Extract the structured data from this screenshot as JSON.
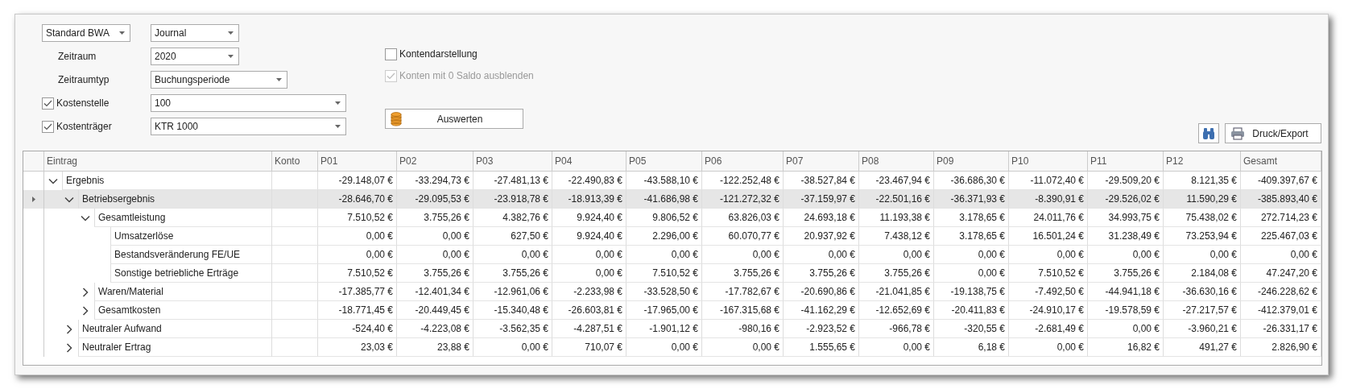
{
  "report_select": {
    "value": "Standard BWA"
  },
  "view_select": {
    "value": "Journal"
  },
  "filters": [
    {
      "kind": "select",
      "label": "Zeitraum",
      "value": "2020"
    },
    {
      "kind": "select",
      "label": "Zeitraumtyp",
      "value": "Buchungsperiode"
    },
    {
      "kind": "checkbox",
      "label": "Kostenstelle",
      "checked": true,
      "value": "100"
    },
    {
      "kind": "checkbox",
      "label": "Kostenträger",
      "checked": true,
      "value": "KTR 1000"
    }
  ],
  "options": [
    {
      "label": "Kontendarstellung",
      "checked": false,
      "disabled": false
    },
    {
      "label": "Konten mit 0 Saldo ausblenden",
      "checked": true,
      "disabled": true
    }
  ],
  "evaluate_button": "Auswerten",
  "export_button": "Druck/Export",
  "table": {
    "columns": [
      "Eintrag",
      "Konto",
      "P01",
      "P02",
      "P03",
      "P04",
      "P05",
      "P06",
      "P07",
      "P08",
      "P09",
      "P10",
      "P11",
      "P12",
      "Gesamt"
    ],
    "rows": [
      {
        "label": "Ergebnis",
        "expanded": true,
        "selected": false,
        "values": [
          "-29.148,07 €",
          "-33.294,73 €",
          "-27.481,13 €",
          "-22.490,83 €",
          "-43.588,10 €",
          "-122.252,48 €",
          "-38.527,84 €",
          "-23.467,94 €",
          "-36.686,30 €",
          "-11.072,40 €",
          "-29.509,20 €",
          "8.121,35 €",
          "-409.397,67 €"
        ],
        "children": [
          {
            "label": "Betriebsergebnis",
            "expanded": true,
            "selected": true,
            "values": [
              "-28.646,70 €",
              "-29.095,53 €",
              "-23.918,78 €",
              "-18.913,39 €",
              "-41.686,98 €",
              "-121.272,32 €",
              "-37.159,97 €",
              "-22.501,16 €",
              "-36.371,93 €",
              "-8.390,91 €",
              "-29.526,02 €",
              "11.590,29 €",
              "-385.893,40 €"
            ],
            "children": [
              {
                "label": "Gesamtleistung",
                "expanded": true,
                "selected": false,
                "values": [
                  "7.510,52 €",
                  "3.755,26 €",
                  "4.382,76 €",
                  "9.924,40 €",
                  "9.806,52 €",
                  "63.826,03 €",
                  "24.693,18 €",
                  "11.193,38 €",
                  "3.178,65 €",
                  "24.011,76 €",
                  "34.993,75 €",
                  "75.438,02 €",
                  "272.714,23 €"
                ],
                "children": [
                  {
                    "label": "Umsatzerlöse",
                    "selected": false,
                    "values": [
                      "0,00 €",
                      "0,00 €",
                      "627,50 €",
                      "9.924,40 €",
                      "2.296,00 €",
                      "60.070,77 €",
                      "20.937,92 €",
                      "7.438,12 €",
                      "3.178,65 €",
                      "16.501,24 €",
                      "31.238,49 €",
                      "73.253,94 €",
                      "225.467,03 €"
                    ]
                  },
                  {
                    "label": "Bestandsveränderung  FE/UE",
                    "selected": false,
                    "values": [
                      "0,00 €",
                      "0,00 €",
                      "0,00 €",
                      "0,00 €",
                      "0,00 €",
                      "0,00 €",
                      "0,00 €",
                      "0,00 €",
                      "0,00 €",
                      "0,00 €",
                      "0,00 €",
                      "0,00 €",
                      "0,00 €"
                    ]
                  },
                  {
                    "label": "Sonstige betriebliche Erträge",
                    "selected": false,
                    "values": [
                      "7.510,52 €",
                      "3.755,26 €",
                      "3.755,26 €",
                      "0,00 €",
                      "7.510,52 €",
                      "3.755,26 €",
                      "3.755,26 €",
                      "3.755,26 €",
                      "0,00 €",
                      "7.510,52 €",
                      "3.755,26 €",
                      "2.184,08 €",
                      "47.247,20 €"
                    ]
                  }
                ]
              },
              {
                "label": "Waren/Material",
                "expanded": false,
                "selected": false,
                "values": [
                  "-17.385,77 €",
                  "-12.401,34 €",
                  "-12.961,06 €",
                  "-2.233,98 €",
                  "-33.528,50 €",
                  "-17.782,67 €",
                  "-20.690,86 €",
                  "-21.041,85 €",
                  "-19.138,75 €",
                  "-7.492,50 €",
                  "-44.941,18 €",
                  "-36.630,16 €",
                  "-246.228,62 €"
                ]
              },
              {
                "label": "Gesamtkosten",
                "expanded": false,
                "selected": false,
                "values": [
                  "-18.771,45 €",
                  "-20.449,45 €",
                  "-15.340,48 €",
                  "-26.603,81 €",
                  "-17.965,00 €",
                  "-167.315,68 €",
                  "-41.162,29 €",
                  "-12.652,69 €",
                  "-20.411,83 €",
                  "-24.910,17 €",
                  "-19.578,59 €",
                  "-27.217,57 €",
                  "-412.379,01 €"
                ]
              }
            ]
          },
          {
            "label": "Neutraler Aufwand",
            "expanded": false,
            "selected": false,
            "values": [
              "-524,40 €",
              "-4.223,08 €",
              "-3.562,35 €",
              "-4.287,51 €",
              "-1.901,12 €",
              "-980,16 €",
              "-2.923,52 €",
              "-966,78 €",
              "-320,55 €",
              "-2.681,49 €",
              "0,00 €",
              "-3.960,21 €",
              "-26.331,17 €"
            ]
          },
          {
            "label": "Neutraler Ertrag",
            "expanded": false,
            "selected": false,
            "values": [
              "23,03 €",
              "23,88 €",
              "0,00 €",
              "710,07 €",
              "0,00 €",
              "0,00 €",
              "1.555,65 €",
              "0,00 €",
              "6,18 €",
              "0,00 €",
              "16,82 €",
              "491,27 €",
              "2.826,90 €"
            ]
          }
        ]
      }
    ]
  }
}
